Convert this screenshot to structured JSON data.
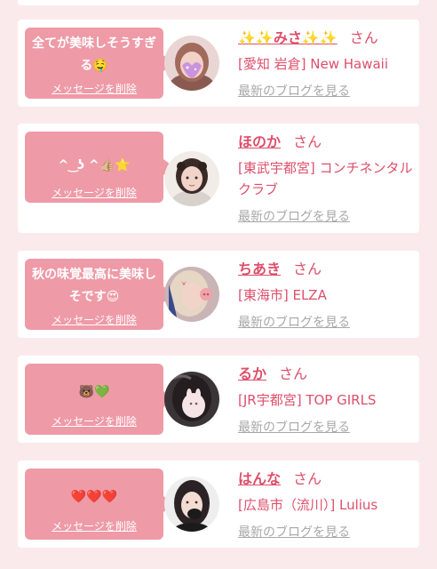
{
  "cards": [
    {
      "message": "全てが美味しそうすぎる🤤",
      "delete_label": "メッセージを削除",
      "name": "✨✨みさ✨✨",
      "honorific": "さん",
      "shop": "[愛知 岩倉] New Hawaii",
      "blog_label": "最新のブログを見る"
    },
    {
      "message": "^ ͜ ʖ ^👍🏼⭐️",
      "delete_label": "メッセージを削除",
      "name": "ほのか",
      "honorific": "さん",
      "shop": "[東武宇都宮] コンチネンタルクラブ",
      "blog_label": "最新のブログを見る"
    },
    {
      "message": "秋の味覚最高に美味しそです😍",
      "delete_label": "メッセージを削除",
      "name": "ちあき",
      "honorific": "さん",
      "shop": "[東海市] ELZA",
      "blog_label": "最新のブログを見る"
    },
    {
      "message": "🐻💚",
      "delete_label": "メッセージを削除",
      "name": "るか",
      "honorific": "さん",
      "shop": "[JR宇都宮] TOP GIRLS",
      "blog_label": "最新のブログを見る"
    },
    {
      "message": "❤️❤️❤️",
      "delete_label": "メッセージを削除",
      "name": "はんな",
      "honorific": "さん",
      "shop": "[広島市（流川）] Lulius",
      "blog_label": "最新のブログを見る"
    }
  ]
}
